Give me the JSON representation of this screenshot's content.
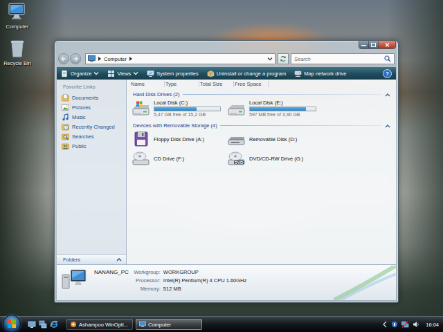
{
  "desktop_icons": [
    {
      "label": "Computer",
      "kind": "computer"
    },
    {
      "label": "Recycle Bin",
      "kind": "recycle-bin"
    }
  ],
  "window": {
    "navigation": {
      "back_enabled": false,
      "forward_enabled": false
    },
    "address": {
      "path": [
        "Computer"
      ]
    },
    "search": {
      "placeholder": "Search"
    },
    "toolbar": {
      "items": [
        {
          "label": "Organize",
          "kind": "organize",
          "dropdown": true
        },
        {
          "label": "Views",
          "kind": "views",
          "dropdown": true
        },
        {
          "label": "System properties",
          "kind": "system-properties",
          "dropdown": false
        },
        {
          "label": "Uninstall or change a program",
          "kind": "uninstall",
          "dropdown": false
        },
        {
          "label": "Map network drive",
          "kind": "map-drive",
          "dropdown": false
        }
      ],
      "help": "?"
    },
    "sidebar": {
      "heading": "Favorite Links",
      "items": [
        {
          "label": "Documents",
          "kind": "documents"
        },
        {
          "label": "Pictures",
          "kind": "pictures"
        },
        {
          "label": "Music",
          "kind": "music"
        },
        {
          "label": "Recently Changed",
          "kind": "recent"
        },
        {
          "label": "Searches",
          "kind": "searches"
        },
        {
          "label": "Public",
          "kind": "public"
        }
      ],
      "folders": {
        "label": "Folders",
        "expanded": false
      }
    },
    "table": {
      "columns": [
        "Name",
        "Type",
        "Total Size",
        "Free Space"
      ]
    },
    "groups": [
      {
        "label": "Hard Disk Drives (2)",
        "expanded": true,
        "items": [
          {
            "name": "Local Disk (C:)",
            "kind": "system-disk",
            "level": 0.64,
            "reading": "5,47 GB free of 15,2 GB"
          },
          {
            "name": "Local Disk (E:)",
            "kind": "disk",
            "level": 0.85,
            "reading": "597 MB free of 3,90 GB"
          }
        ]
      },
      {
        "label": "Devices with Removable Storage (4)",
        "expanded": true,
        "items": [
          {
            "name": "Floppy Disk Drive (A:)",
            "kind": "floppy"
          },
          {
            "name": "Removable Disk (D:)",
            "kind": "removable"
          },
          {
            "name": "CD Drive (F:)",
            "kind": "cd"
          },
          {
            "name": "DVD/CD-RW Drive (G:)",
            "kind": "dvd",
            "badge": "DVD"
          }
        ]
      }
    ],
    "details": {
      "computer_name": "NANANG_PC",
      "fields": [
        {
          "label": "Workgroup:",
          "value": "WORKGROUP"
        },
        {
          "label": "Processor:",
          "value": "Intel(R) Pentium(R) 4 CPU 1.60GHz"
        },
        {
          "label": "Memory:",
          "value": "512 MB"
        }
      ]
    }
  },
  "taskbar": {
    "tasks": [
      {
        "label": "Ashampoo WinOpti...",
        "kind": "app",
        "selected": false
      },
      {
        "label": "Computer",
        "kind": "explorer",
        "selected": true
      }
    ],
    "clock": "16:04"
  }
}
